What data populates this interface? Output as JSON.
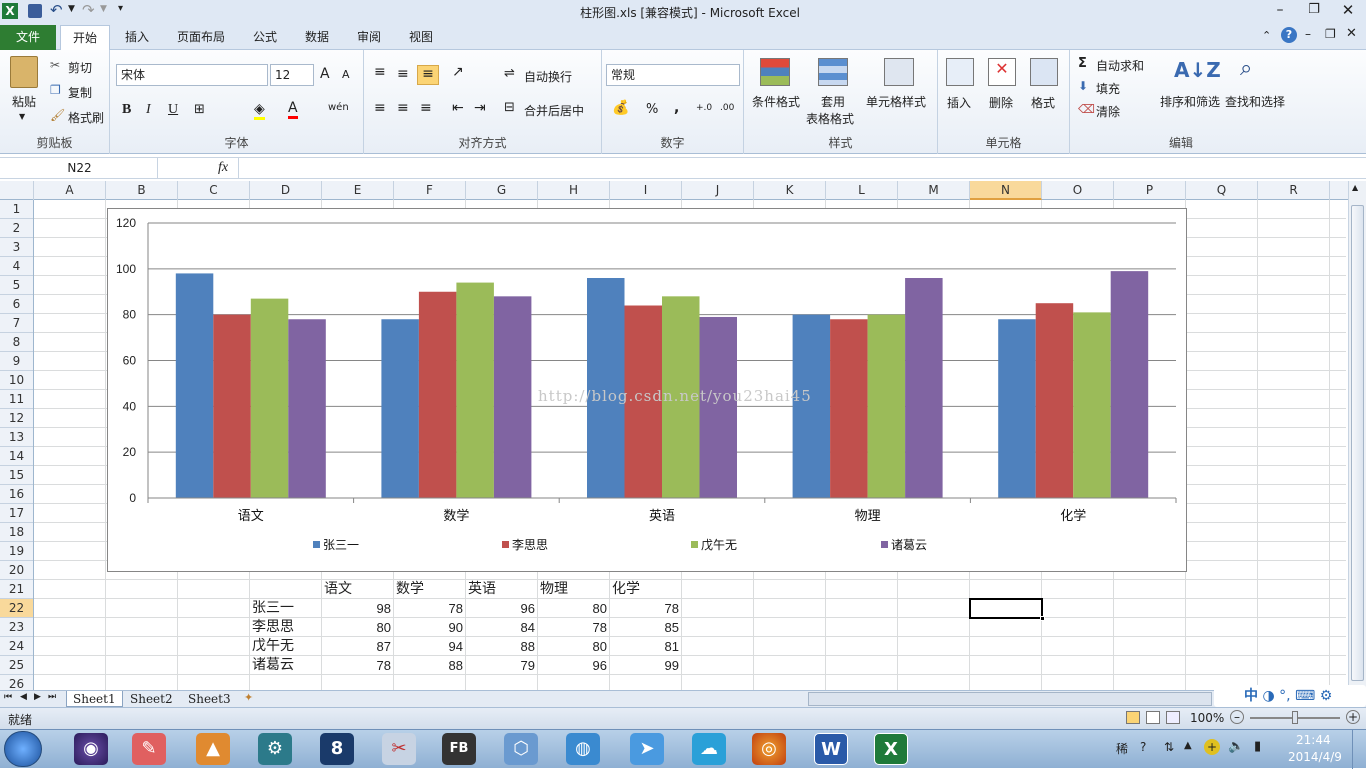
{
  "window": {
    "title": "柱形图.xls  [兼容模式]  -  Microsoft Excel",
    "app_icon": "X"
  },
  "quick_access": {
    "save_icon": "save-icon",
    "undo_icon": "undo-icon",
    "redo_icon": "redo-icon"
  },
  "ribbon_tabs": [
    "文件",
    "开始",
    "插入",
    "页面布局",
    "公式",
    "数据",
    "审阅",
    "视图"
  ],
  "active_tab": "开始",
  "clipboard": {
    "paste": "粘贴",
    "cut": "剪切",
    "copy": "复制",
    "format_painter": "格式刷",
    "label": "剪贴板"
  },
  "font": {
    "name": "宋体",
    "size": "12",
    "bold": "B",
    "italic": "I",
    "underline": "U",
    "grow": "A",
    "shrink": "A",
    "wen": "wén",
    "label": "字体"
  },
  "alignment": {
    "wrap": "自动换行",
    "merge": "合并后居中",
    "label": "对齐方式"
  },
  "number": {
    "format": "常规",
    "percent": "%",
    "comma": ",",
    "inc": "+.0",
    "dec": ".00",
    "label": "数字"
  },
  "styles": {
    "conditional": "条件格式",
    "table": "套用",
    "table2": "表格格式",
    "cell": "单元格样式",
    "label": "样式"
  },
  "cells": {
    "insert": "插入",
    "delete": "删除",
    "format": "格式",
    "label": "单元格"
  },
  "editing": {
    "autosum": "自动求和",
    "fill": "填充",
    "clear": "清除",
    "sort": "排序和筛选",
    "find": "查找和选择",
    "label": "编辑"
  },
  "formula_bar": {
    "name_box": "N22",
    "fx": "fx",
    "value": ""
  },
  "columns": [
    "A",
    "B",
    "C",
    "D",
    "E",
    "F",
    "G",
    "H",
    "I",
    "J",
    "K",
    "L",
    "M",
    "N",
    "O",
    "P",
    "Q",
    "R"
  ],
  "rows": [
    "1",
    "2",
    "3",
    "4",
    "5",
    "6",
    "7",
    "8",
    "9",
    "10",
    "11",
    "12",
    "13",
    "14",
    "15",
    "16",
    "17",
    "18",
    "19",
    "20",
    "21",
    "22",
    "23",
    "24",
    "25",
    "26"
  ],
  "selected_cell": {
    "col": "N",
    "row": "22"
  },
  "table": {
    "headers": [
      "语文",
      "数学",
      "英语",
      "物理",
      "化学"
    ],
    "rows": [
      {
        "name": "张三一",
        "values": [
          98,
          78,
          96,
          80,
          78
        ]
      },
      {
        "name": "李思思",
        "values": [
          80,
          90,
          84,
          78,
          85
        ]
      },
      {
        "name": "戊午无",
        "values": [
          87,
          94,
          88,
          80,
          81
        ]
      },
      {
        "name": "诸葛云",
        "values": [
          78,
          88,
          79,
          96,
          99
        ]
      }
    ]
  },
  "chart_data": {
    "type": "bar",
    "categories": [
      "语文",
      "数学",
      "英语",
      "物理",
      "化学"
    ],
    "series": [
      {
        "name": "张三一",
        "values": [
          98,
          78,
          96,
          80,
          78
        ],
        "color": "#4f81bd"
      },
      {
        "name": "李思思",
        "values": [
          80,
          90,
          84,
          78,
          85
        ],
        "color": "#c0504d"
      },
      {
        "name": "戊午无",
        "values": [
          87,
          94,
          88,
          80,
          81
        ],
        "color": "#9bbb59"
      },
      {
        "name": "诸葛云",
        "values": [
          78,
          88,
          79,
          96,
          99
        ],
        "color": "#8064a2"
      }
    ],
    "ylim": [
      0,
      120
    ],
    "yticks": [
      0,
      20,
      40,
      60,
      80,
      100,
      120
    ],
    "grid": true,
    "legend": "bottom",
    "watermark": "http://blog.csdn.net/you23hai45"
  },
  "sheets": [
    "Sheet1",
    "Sheet2",
    "Sheet3"
  ],
  "active_sheet": "Sheet1",
  "status": {
    "ready": "就绪",
    "zoom": "100%"
  },
  "taskbar": {
    "time": "21:44",
    "date": "2014/4/9",
    "ime": "中"
  }
}
